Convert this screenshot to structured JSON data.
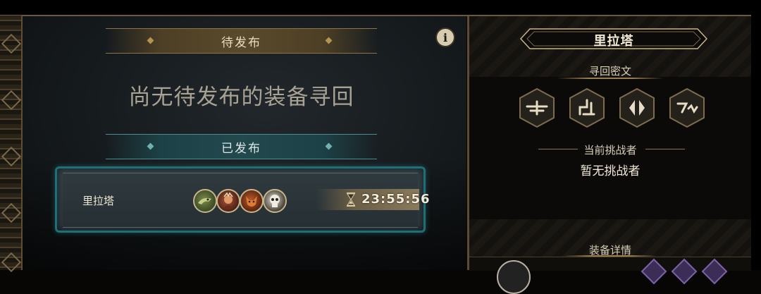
{
  "left": {
    "pending_label": "待发布",
    "empty_message": "尚无待发布的装备寻回",
    "posted_label": "已发布",
    "posted_entry": {
      "name": "里拉塔",
      "timer": "23:55:56",
      "participant_icons": [
        "lizard-portrait-icon",
        "warrior-portrait-icon",
        "fox-portrait-icon",
        "skull-portrait-icon"
      ]
    }
  },
  "right": {
    "character_name": "里拉塔",
    "recover_cipher_label": "寻回密文",
    "cipher_icons": [
      "cipher-rune-1-icon",
      "cipher-rune-2-icon",
      "cipher-rune-3-icon",
      "cipher-rune-4-icon"
    ],
    "current_challenger_label": "当前挑战者",
    "current_challenger_value": "暂无挑战者",
    "equipment_details_label": "装备详情"
  },
  "colors": {
    "gold_accent": "#8a7448",
    "teal_accent": "#1f6f76",
    "text_light": "#e7ddc6"
  }
}
